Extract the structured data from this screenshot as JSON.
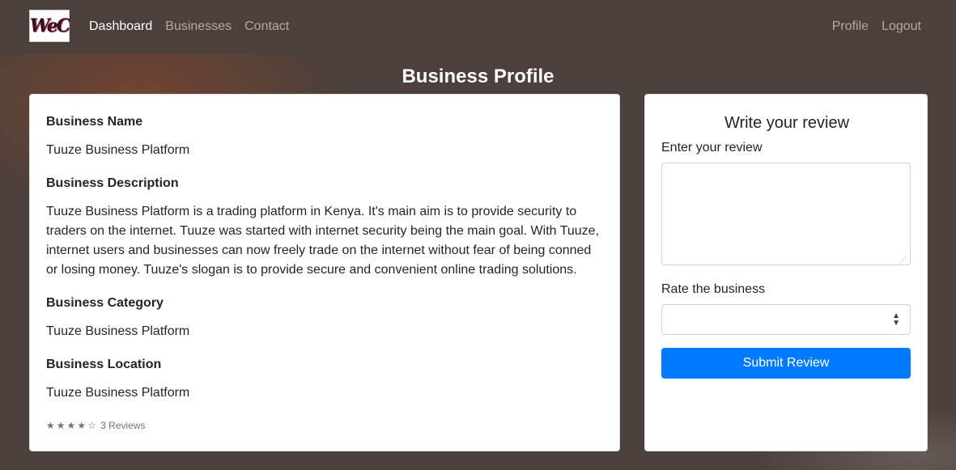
{
  "nav": {
    "logo_text": "WeC",
    "left_links": [
      "Dashboard",
      "Businesses",
      "Contact"
    ],
    "right_links": [
      "Profile",
      "Logout"
    ],
    "active": "Dashboard"
  },
  "page": {
    "title": "Business Profile"
  },
  "business": {
    "name_label": "Business Name",
    "name_value": "Tuuze Business Platform",
    "description_label": "Business Description",
    "description_value": "Tuuze Business Platform is a trading platform in Kenya. It's main aim is to provide security to traders on the internet. Tuuze was started with internet security being the main goal. With Tuuze, internet users and businesses can now freely trade on the internet without fear of being conned or losing money. Tuuze's slogan is to provide secure and convenient online trading solutions.",
    "category_label": "Business Category",
    "category_value": "Tuuze Business Platform",
    "location_label": "Business Location",
    "location_value": "Tuuze Business Platform",
    "rating_stars": 4,
    "rating_max": 5,
    "reviews_text": "3 Reviews"
  },
  "review_form": {
    "title": "Write your review",
    "review_label": "Enter your review",
    "review_value": "",
    "rate_label": "Rate the business",
    "rate_value": "",
    "submit_label": "Submit Review"
  },
  "colors": {
    "background": "#4b403b",
    "accent": "#007bff"
  },
  "icons": {
    "star_filled": "★",
    "star_empty": "☆",
    "select_arrow": "⬍"
  }
}
